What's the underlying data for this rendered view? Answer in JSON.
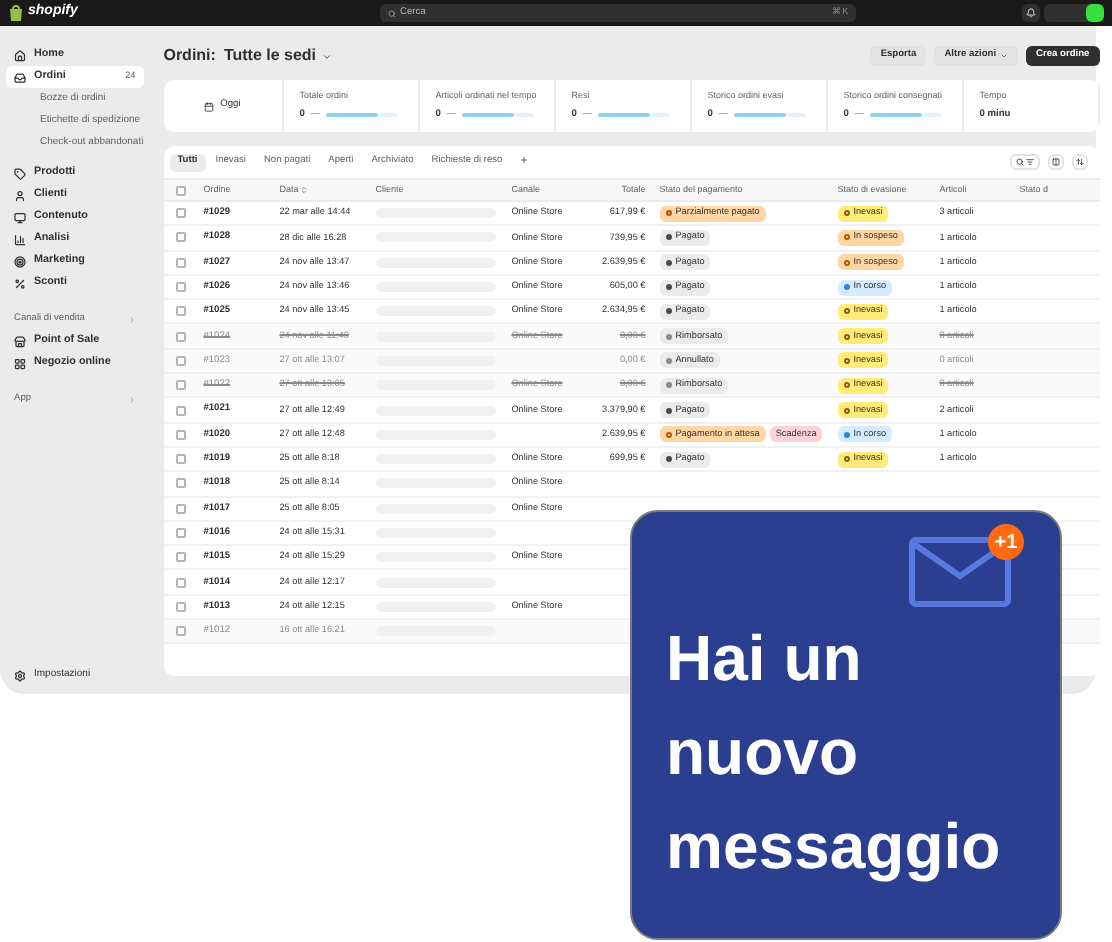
{
  "top_bar": {
    "logo": "shopify",
    "search": {
      "placeholder": "Cerca",
      "shortcut": "⌘ K"
    }
  },
  "sidebar": {
    "nav": [
      {
        "label": "Home",
        "selected": false
      },
      {
        "label": "Ordini",
        "selected": true,
        "count": "24",
        "children": [
          {
            "label": "Bozze di ordini",
            "selected": false
          },
          {
            "label": "Etichette di spedizione",
            "selected": false
          },
          {
            "label": "Check-out abbandonati",
            "selected": false
          }
        ]
      },
      {
        "label": "Prodotti",
        "selected": false
      },
      {
        "label": "Clienti",
        "selected": false
      },
      {
        "label": "Contenuto",
        "selected": false
      },
      {
        "label": "Analisi",
        "selected": false
      },
      {
        "label": "Marketing",
        "selected": false
      },
      {
        "label": "Sconti",
        "selected": false
      }
    ],
    "sections": [
      {
        "title": "Canali di vendita",
        "items": [
          {
            "label": "Point of Sale",
            "selected": false
          },
          {
            "label": "Negozio online",
            "selected": false
          }
        ]
      },
      {
        "title": "App"
      }
    ],
    "footer": "Impostazioni"
  },
  "header": {
    "title": "Ordini:",
    "location": "Tutte le sedi",
    "buttons": [
      {
        "label": "Esporta",
        "kind": "secondary"
      },
      {
        "label": "Altre azioni",
        "kind": "menu"
      },
      {
        "label": "Crea ordine",
        "kind": "primary"
      }
    ]
  },
  "stats": {
    "date_button": "Oggi",
    "metrics": [
      {
        "label": "Totale ordini",
        "value": "0",
        "change": "—"
      },
      {
        "label": "Articoli ordinati nel tempo",
        "value": "0",
        "change": "—"
      },
      {
        "label": "Resi",
        "value": "0",
        "change": "—"
      },
      {
        "label": "Storico ordini evasi",
        "value": "0",
        "change": "—"
      },
      {
        "label": "Storico ordini consegnati",
        "value": "0",
        "change": "—"
      },
      {
        "label": "Tempo",
        "value": "0 minu"
      }
    ]
  },
  "tabs": [
    {
      "label": "Tutti",
      "selected": true
    },
    {
      "label": "Inevasi",
      "selected": false
    },
    {
      "label": "Non pagati",
      "selected": false
    },
    {
      "label": "Aperti",
      "selected": false
    },
    {
      "label": "Archiviato",
      "selected": false
    },
    {
      "label": "Richieste di reso",
      "selected": false
    }
  ],
  "add_tab": "+",
  "table": {
    "all_selected": false,
    "columns": [
      "Ordine",
      "Data",
      "Cliente",
      "Canale",
      "Totale",
      "Stato del pagamento",
      "Stato di evasione",
      "Articoli",
      "Stato d"
    ],
    "rows": [
      {
        "order": "#1029",
        "date": "22 mar alle 14:44",
        "channel": "Online Store",
        "total": "617,99 €",
        "payment": [
          {
            "label": "Parzialmente pagato",
            "kind": "partial"
          }
        ],
        "fulfillment": {
          "label": "Inevasi",
          "kind": "unfulfilled"
        },
        "items": "3 articoli",
        "selected": false,
        "struck": false,
        "faded": false
      },
      {
        "order": "#1028",
        "date": "28 dic alle 16:28",
        "channel": "Online Store",
        "total": "739,95 €",
        "payment": [
          {
            "label": "Pagato",
            "kind": "paid"
          }
        ],
        "fulfillment": {
          "label": "In sospeso",
          "kind": "on_hold"
        },
        "items": "1 articolo",
        "selected": false,
        "struck": false,
        "faded": false
      },
      {
        "order": "#1027",
        "date": "24 nov alle 13:47",
        "channel": "Online Store",
        "total": "2.639,95 €",
        "payment": [
          {
            "label": "Pagato",
            "kind": "paid"
          }
        ],
        "fulfillment": {
          "label": "In sospeso",
          "kind": "on_hold"
        },
        "items": "1 articolo",
        "selected": false,
        "struck": false,
        "faded": false
      },
      {
        "order": "#1026",
        "date": "24 nov alle 13:46",
        "channel": "Online Store",
        "total": "605,00 €",
        "payment": [
          {
            "label": "Pagato",
            "kind": "paid"
          }
        ],
        "fulfillment": {
          "label": "In corso",
          "kind": "in_progress"
        },
        "items": "1 articolo",
        "selected": false,
        "struck": false,
        "faded": false
      },
      {
        "order": "#1025",
        "date": "24 nov alle 13:45",
        "channel": "Online Store",
        "total": "2.634,95 €",
        "payment": [
          {
            "label": "Pagato",
            "kind": "paid"
          }
        ],
        "fulfillment": {
          "label": "Inevasi",
          "kind": "unfulfilled"
        },
        "items": "1 articolo",
        "selected": false,
        "struck": false,
        "faded": false
      },
      {
        "order": "#1024",
        "date": "24 nov alle 11:40",
        "channel": "Online Store",
        "total": "0,00 €",
        "payment": [
          {
            "label": "Rimborsato",
            "kind": "refunded"
          }
        ],
        "fulfillment": {
          "label": "Inevasi",
          "kind": "unfulfilled"
        },
        "items": "0 articoli",
        "selected": false,
        "struck": true,
        "faded": true
      },
      {
        "order": "#1023",
        "date": "27 ott alle 13:07",
        "total": "0,00 €",
        "payment": [
          {
            "label": "Annullato",
            "kind": "cancelled"
          }
        ],
        "fulfillment": {
          "label": "Inevasi",
          "kind": "unfulfilled"
        },
        "items": "0 articoli",
        "selected": false,
        "struck": false,
        "faded": true
      },
      {
        "order": "#1022",
        "date": "27 ott alle 13:05",
        "channel": "Online Store",
        "total": "0,00 €",
        "payment": [
          {
            "label": "Rimborsato",
            "kind": "refunded"
          }
        ],
        "fulfillment": {
          "label": "Inevasi",
          "kind": "unfulfilled"
        },
        "items": "0 articoli",
        "selected": false,
        "struck": true,
        "faded": true
      },
      {
        "order": "#1021",
        "date": "27 ott alle 12:49",
        "channel": "Online Store",
        "total": "3.379,90 €",
        "payment": [
          {
            "label": "Pagato",
            "kind": "paid"
          }
        ],
        "fulfillment": {
          "label": "Inevasi",
          "kind": "unfulfilled"
        },
        "items": "2 articoli",
        "selected": false,
        "struck": false,
        "faded": false
      },
      {
        "order": "#1020",
        "date": "27 ott alle 12:48",
        "total": "2.639,95 €",
        "payment": [
          {
            "label": "Pagamento in attesa",
            "kind": "pending"
          },
          {
            "label": "Scadenza",
            "kind": "overdue"
          }
        ],
        "fulfillment": {
          "label": "In corso",
          "kind": "in_progress"
        },
        "items": "1 articolo",
        "selected": false,
        "struck": false,
        "faded": false
      },
      {
        "order": "#1019",
        "date": "25 ott alle 8:18",
        "channel": "Online Store",
        "total": "699,95 €",
        "payment": [
          {
            "label": "Pagato",
            "kind": "paid"
          }
        ],
        "fulfillment": {
          "label": "Inevasi",
          "kind": "unfulfilled"
        },
        "items": "1 articolo",
        "selected": false,
        "struck": false,
        "faded": false
      },
      {
        "order": "#1018",
        "date": "25 ott alle 8:14",
        "channel": "Online Store",
        "selected": false,
        "struck": false,
        "faded": false
      },
      {
        "order": "#1017",
        "date": "25 ott alle 8:05",
        "channel": "Online Store",
        "selected": false,
        "struck": false,
        "faded": false
      },
      {
        "order": "#1016",
        "date": "24 ott alle 15:31",
        "selected": false,
        "struck": false,
        "faded": false
      },
      {
        "order": "#1015",
        "date": "24 ott alle 15:29",
        "channel": "Online Store",
        "selected": false,
        "struck": false,
        "faded": false
      },
      {
        "order": "#1014",
        "date": "24 ott alle 12:17",
        "selected": false,
        "struck": false,
        "faded": false
      },
      {
        "order": "#1013",
        "date": "24 ott alle 12:15",
        "channel": "Online Store",
        "selected": false,
        "struck": false,
        "faded": false
      },
      {
        "order": "#1012",
        "date": "16 ott alle 16:21",
        "selected": false,
        "struck": false,
        "faded": true
      }
    ]
  },
  "notification": {
    "message": "Hai un nuovo messaggio",
    "badge": "+1"
  }
}
